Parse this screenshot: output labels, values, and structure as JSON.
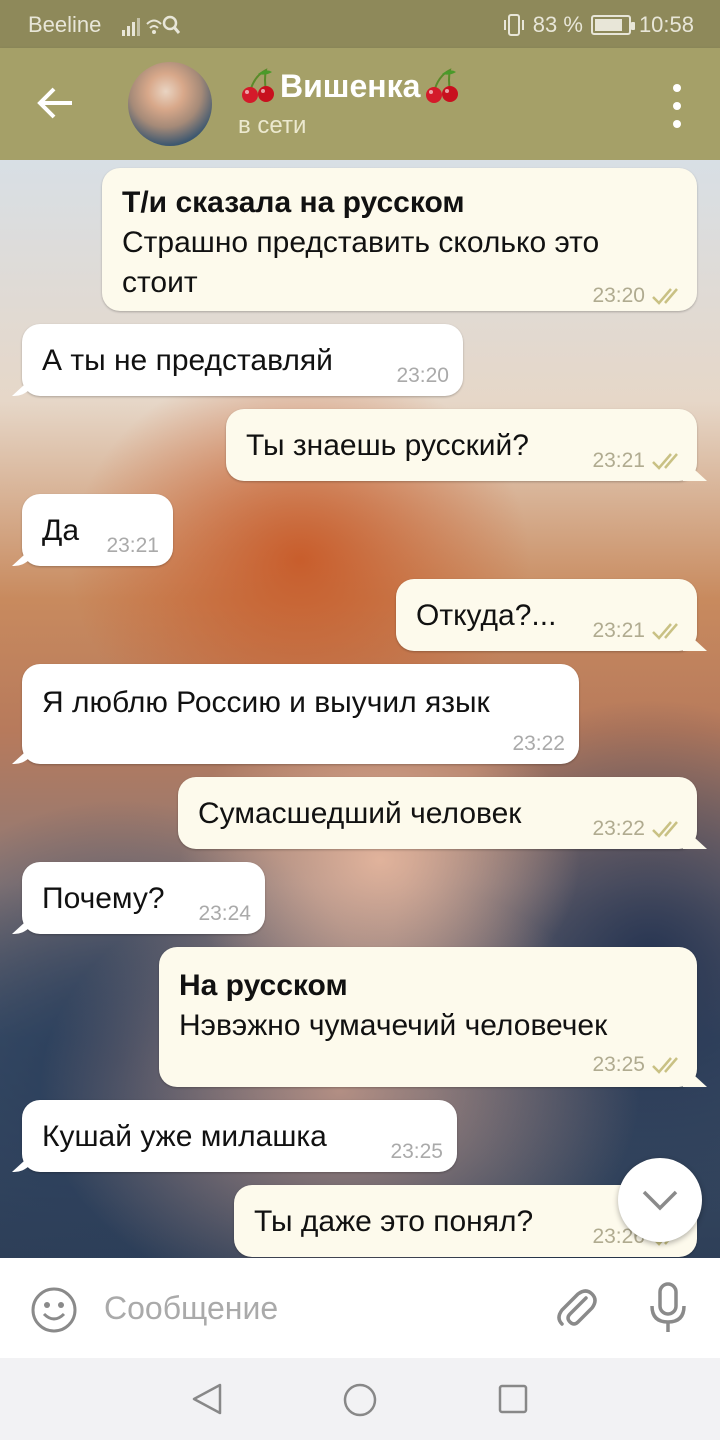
{
  "status_bar": {
    "carrier": "Beeline",
    "battery_text": "83 %",
    "battery_level": 0.83,
    "time": "10:58"
  },
  "header": {
    "name": "Вишенка",
    "name_decoration_icon": "cherry-icon",
    "status": "в сети"
  },
  "messages": [
    {
      "dir": "out",
      "title": "Т/и сказала на русском",
      "text": "Страшно представить сколько это",
      "text2": "стоит",
      "time": "23:20",
      "read": true
    },
    {
      "dir": "in",
      "text": "А ты не представляй",
      "time": "23:20"
    },
    {
      "dir": "out",
      "text": "Ты знаешь русский?",
      "time": "23:21",
      "read": true
    },
    {
      "dir": "in",
      "text": "Да",
      "time": "23:21"
    },
    {
      "dir": "out",
      "text": "Откуда?...",
      "time": "23:21",
      "read": true
    },
    {
      "dir": "in",
      "text": "Я люблю Россию и выучил язык",
      "time": "23:22"
    },
    {
      "dir": "out",
      "text": "Сумасшедший человек",
      "time": "23:22",
      "read": true
    },
    {
      "dir": "in",
      "text": "Почему?",
      "time": "23:24"
    },
    {
      "dir": "out",
      "title": "На русском",
      "text": "Нэвэжно чумачечий человечек",
      "time": "23:25",
      "read": true
    },
    {
      "dir": "in",
      "text": "Кушай уже милашка",
      "time": "23:25"
    },
    {
      "dir": "out",
      "text": "Ты даже это понял?",
      "time": "23:26",
      "read": true
    }
  ],
  "input": {
    "placeholder": "Сообщение"
  },
  "colors": {
    "status_bar": "#8e895a",
    "header": "#a5a068",
    "outgoing_bubble": "#fdfaec",
    "incoming_bubble": "#ffffff",
    "read_check": "#c9c184"
  }
}
